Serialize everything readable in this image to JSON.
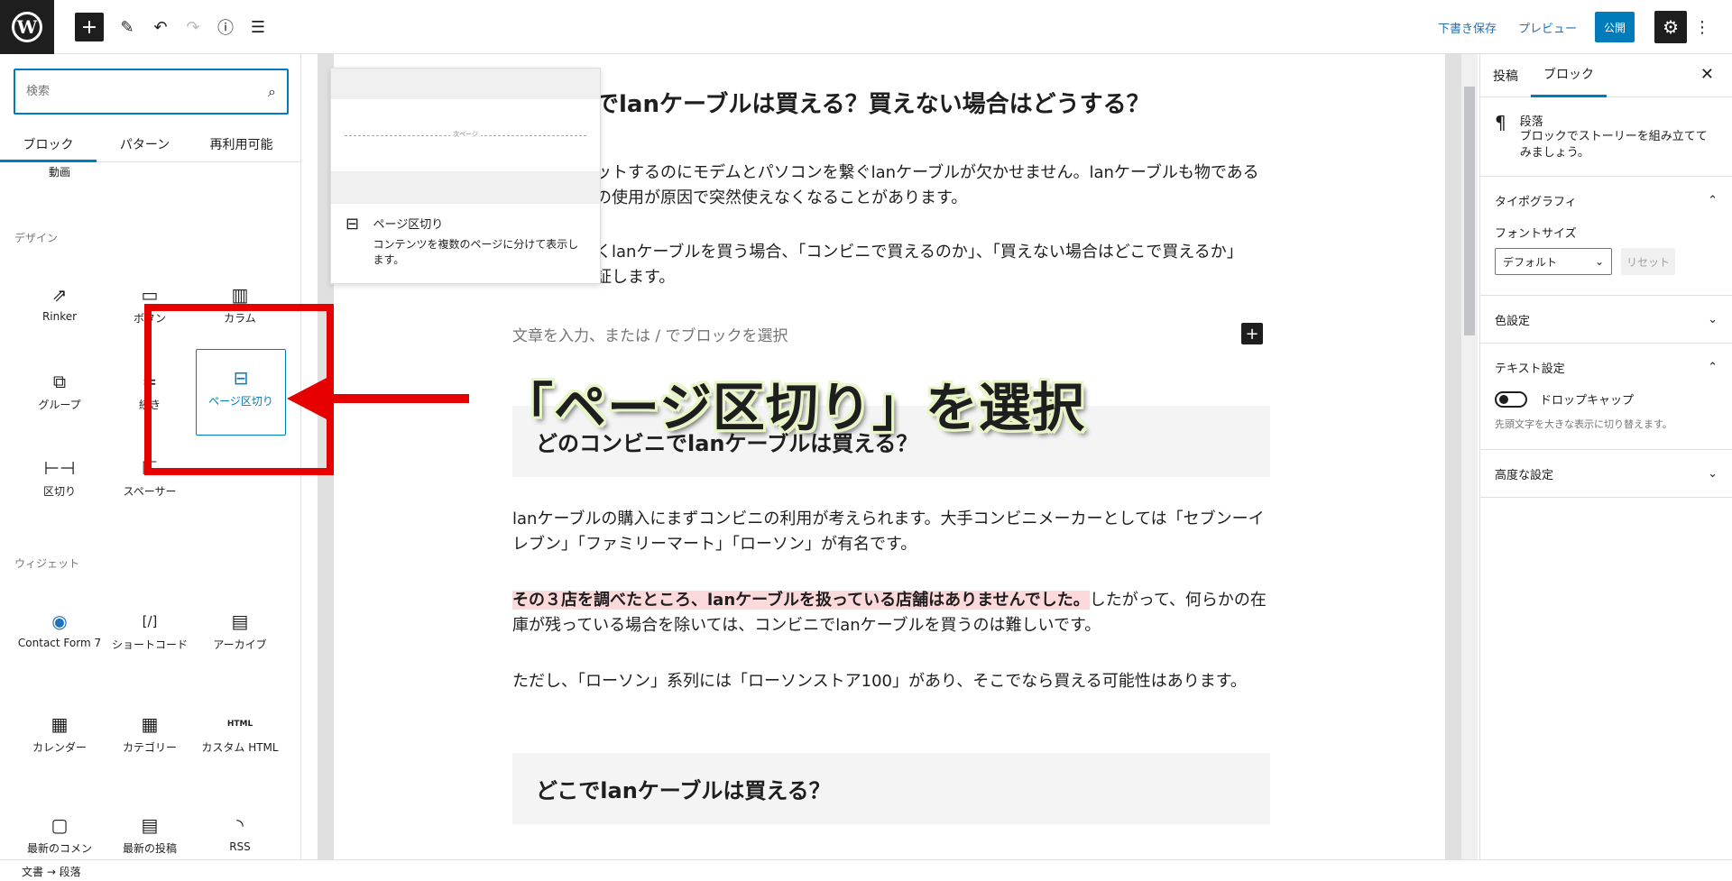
{
  "topbar": {
    "logo": "W",
    "add_icon": "+",
    "edit_icon": "✎",
    "undo_icon": "↶",
    "redo_icon": "↷",
    "info_icon": "ⓘ",
    "list_icon": "☰",
    "draft_label": "下書き保存",
    "preview_label": "プレビュー",
    "publish_label": "公開",
    "settings_icon": "⚙",
    "more_icon": "⋮"
  },
  "inserter": {
    "search_placeholder": "検索",
    "search_icon": "⌕",
    "tabs": [
      "ブロック",
      "パターン",
      "再利用可能"
    ],
    "partial_item": "動画",
    "design_label": "デザイン",
    "design_blocks": [
      {
        "label": "Rinker",
        "icon": "⇗"
      },
      {
        "label": "ボタン",
        "icon": "▭"
      },
      {
        "label": "カラム",
        "icon": "▥"
      },
      {
        "label": "グループ",
        "icon": "⧉"
      },
      {
        "label": "続き",
        "icon": "≑"
      },
      {
        "label": "ページ区切り",
        "icon": "⊟"
      },
      {
        "label": "区切り",
        "icon": "⊢⊣"
      },
      {
        "label": "スペーサー",
        "icon": "⇱"
      }
    ],
    "widget_label": "ウィジェット",
    "widget_blocks": [
      {
        "label": "Contact Form 7",
        "icon": "◉"
      },
      {
        "label": "ショートコード",
        "icon": "[/]"
      },
      {
        "label": "アーカイブ",
        "icon": "▤"
      },
      {
        "label": "カレンダー",
        "icon": "▦"
      },
      {
        "label": "カテゴリー",
        "icon": "▦"
      },
      {
        "label": "カスタム HTML",
        "icon": "HTML"
      },
      {
        "label": "最新のコメン",
        "icon": "▢"
      },
      {
        "label": "最新の投稿",
        "icon": "▤"
      },
      {
        "label": "RSS",
        "icon": "◝"
      }
    ]
  },
  "popover": {
    "preview_text": "次ページ",
    "title": "ページ区切り",
    "description": "コンテンツを複数のページに分けて表示します。",
    "icon": "⊟"
  },
  "content": {
    "title": "でlanケーブルは買える？買えない場合はどうする？",
    "para1": "ットするのにモデムとパソコンを繋ぐlanケーブルが欠かせません。lanケーブルも物である の使用が原因で突然使えなくなることがあります。",
    "para2": "くlanケーブルを買う場合、「コンビニで買えるのか」、「買えない場合はどこで買えるか」 証します。",
    "placeholder": "文章を入力、または / でブロックを選択",
    "heading1": "どのコンビニでlanケーブルは買える？",
    "para3": "lanケーブルの購入にまずコンビニの利用が考えられます。大手コンビニメーカーとしては「セブンーイレブン」「ファミリーマート」「ローソン」が有名です。",
    "para4_highlight": "その３店を調べたところ、lanケーブルを扱っている店舗はありませんでした。",
    "para4_rest": "したがって、何らかの在庫が残っている場合を除いては、コンビニでlanケーブルを買うのは難しいです。",
    "para5": "ただし、「ローソン」系列には「ローソンストア100」があり、そこでなら買える可能性はあります。",
    "heading2": "どこでlanケーブルは買える？"
  },
  "sidebar": {
    "tabs": [
      "投稿",
      "ブロック"
    ],
    "close_icon": "✕",
    "block_icon": "¶",
    "block_name": "段落",
    "block_desc": "ブロックでストーリーを組み立ててみましょう。",
    "typography_label": "タイポグラフィ",
    "font_size_label": "フォントサイズ",
    "font_size_value": "デフォルト",
    "reset_label": "リセット",
    "color_label": "色設定",
    "text_settings_label": "テキスト設定",
    "dropcap_label": "ドロップキャップ",
    "dropcap_help": "先頭文字を大きな表示に切り替えます。",
    "advanced_label": "高度な設定",
    "chevron_up": "⌃",
    "chevron_down": "⌄"
  },
  "footer": {
    "breadcrumb": "文書 → 段落"
  },
  "annotation": {
    "callout": "「ページ区切り」を選択"
  }
}
